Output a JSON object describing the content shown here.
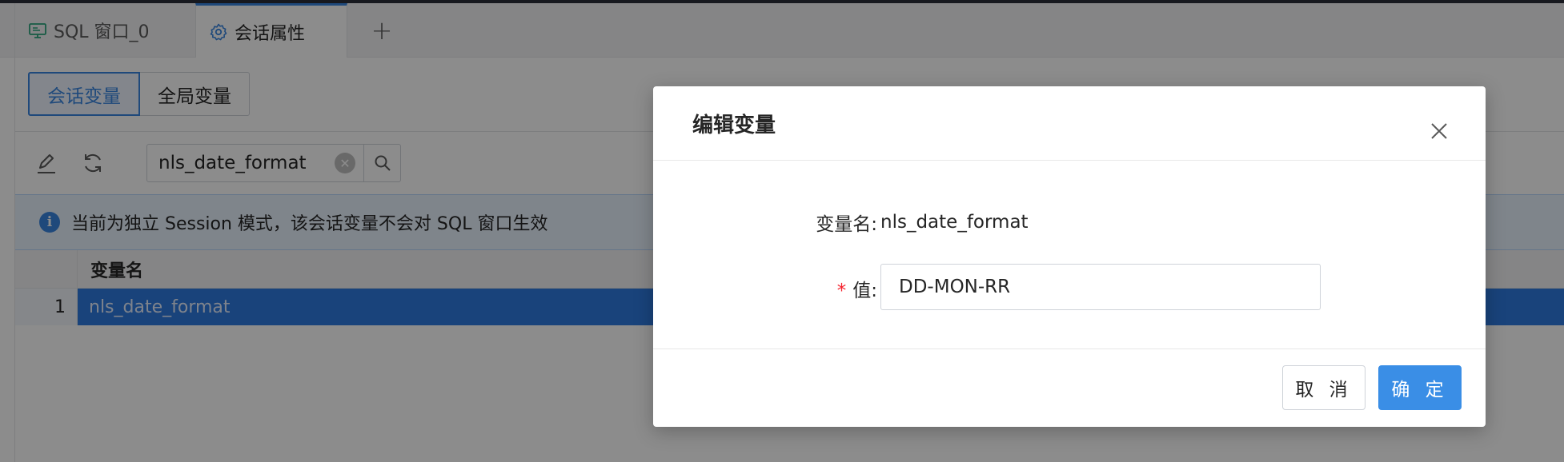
{
  "tabs": [
    {
      "label": "SQL 窗口_0",
      "icon": "monitor-icon"
    },
    {
      "label": "会话属性",
      "icon": "gear-icon"
    }
  ],
  "add_tab": "+",
  "segment": {
    "session_vars": "会话变量",
    "global_vars": "全局变量"
  },
  "search": {
    "value": "nls_date_format"
  },
  "alert": {
    "text": "当前为独立 Session 模式，该会话变量不会对 SQL 窗口生效"
  },
  "table": {
    "columns": [
      "变量名"
    ],
    "rows": [
      {
        "index": "1",
        "name": "nls_date_format"
      }
    ]
  },
  "modal": {
    "title": "编辑变量",
    "var_name_label": "变量名:",
    "var_name_value": "nls_date_format",
    "value_label": "值:",
    "value_required_mark": "*",
    "value_input": "DD-MON-RR",
    "cancel": "取 消",
    "ok": "确 定"
  },
  "colors": {
    "accent": "#3a86e0",
    "selected_row": "#2f7ae0",
    "ok_button": "#3a8ee6"
  }
}
